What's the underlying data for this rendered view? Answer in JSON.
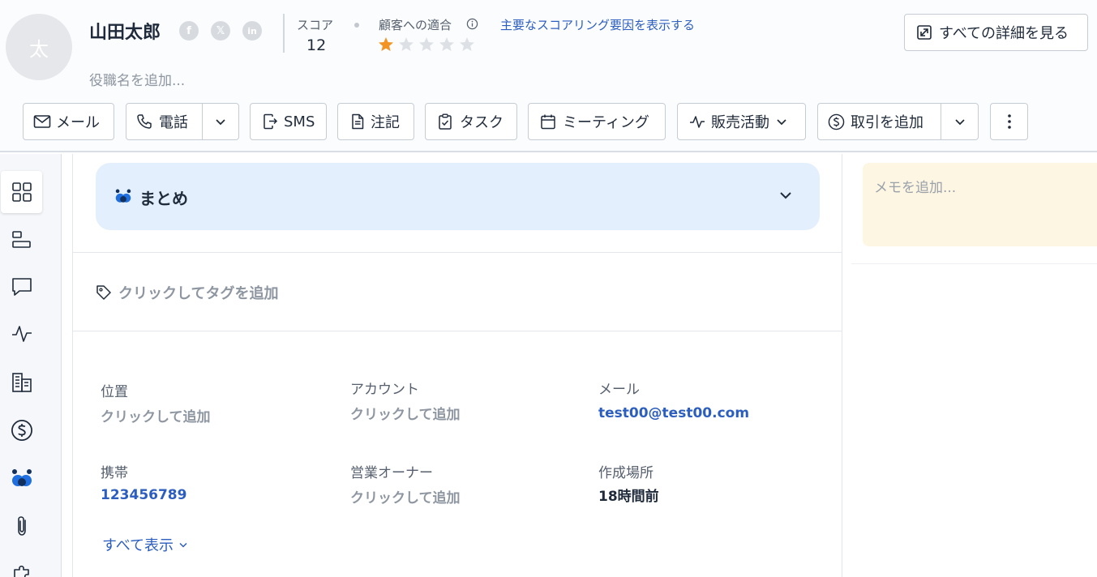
{
  "header": {
    "avatar_initial": "太",
    "name": "山田太郎",
    "job_title_placeholder": "役職名を追加...",
    "score_label": "スコア",
    "score_value": "12",
    "fit_label": "顧客への適合",
    "fit_rating": 1,
    "fit_rating_max": 5,
    "scoring_factors_link": "主要なスコアリング要因を表示する",
    "view_all_details": "すべての詳細を見る",
    "social": [
      "facebook-icon",
      "x-icon",
      "linkedin-icon"
    ]
  },
  "actions": {
    "email": "メール",
    "call": "電話",
    "sms": "SMS",
    "note": "注記",
    "task": "タスク",
    "meeting": "ミーティング",
    "sales_activity": "販売活動",
    "add_deal": "取引を追加"
  },
  "leftnav": {
    "items": [
      "overview-icon",
      "timeline-icon",
      "chat-icon",
      "activity-icon",
      "company-icon",
      "deal-icon",
      "ai-icon",
      "attachment-icon",
      "integration-icon"
    ]
  },
  "summary": {
    "title": "まとめ"
  },
  "tags": {
    "add_label": "クリックしてタグを追加"
  },
  "fields": {
    "location_label": "位置",
    "location_value": "クリックして追加",
    "account_label": "アカウント",
    "account_value": "クリックして追加",
    "email_label": "メール",
    "email_value": "test00@test00.com",
    "mobile_label": "携帯",
    "mobile_value": "123456789",
    "owner_label": "営業オーナー",
    "owner_value": "クリックして追加",
    "created_label": "作成場所",
    "created_value": "18時間前",
    "show_all": "すべて表示"
  },
  "memo": {
    "placeholder": "メモを追加..."
  },
  "colors": {
    "accent": "#2c5ebf",
    "star": "#f29423",
    "summary_bg": "#e3effc",
    "memo_bg": "#fdf6e2"
  }
}
